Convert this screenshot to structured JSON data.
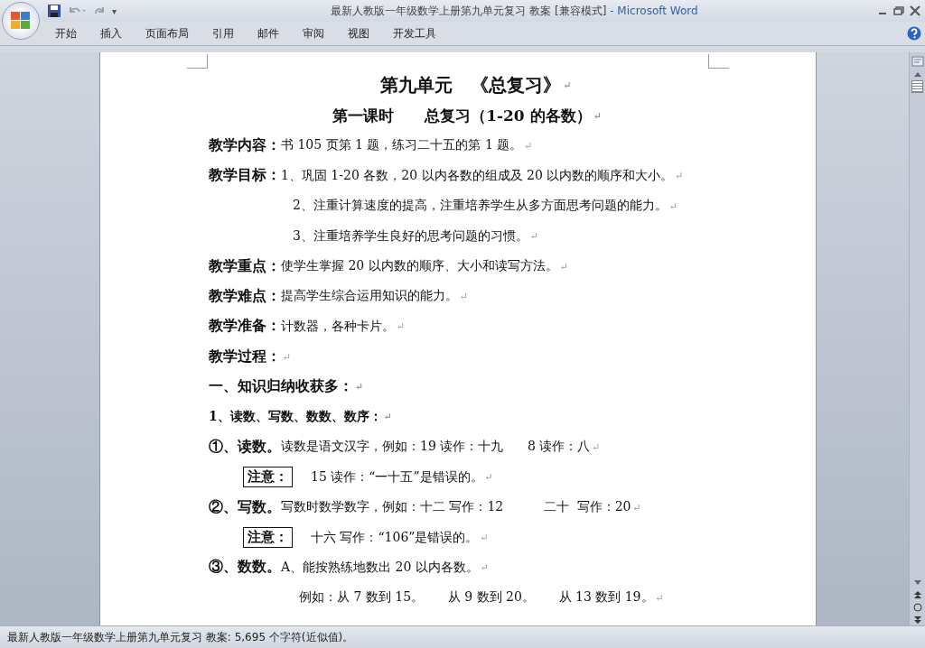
{
  "window": {
    "title": "最新人教版一年级数学上册第九单元复习 教案 [兼容模式]",
    "app": " - Microsoft Word",
    "quick_access": [
      "▾"
    ]
  },
  "tabs": [
    {
      "label": "开始",
      "selected": false
    },
    {
      "label": "插入",
      "selected": false
    },
    {
      "label": "页面布局",
      "selected": false
    },
    {
      "label": "引用",
      "selected": false
    },
    {
      "label": "邮件",
      "selected": false
    },
    {
      "label": "审阅",
      "selected": false
    },
    {
      "label": "视图",
      "selected": false
    },
    {
      "label": "开发工具",
      "selected": false
    }
  ],
  "document": {
    "lines": [
      {
        "kind": "title",
        "text": "第九单元　《总复习》",
        "end": "↵"
      },
      {
        "kind": "subtitle",
        "text": "第一课时　　总复习（1-20 的各数）",
        "end": "↵"
      },
      {
        "kind": "field",
        "label": "教学内容：",
        "text": "书 105 页第 1 题，练习二十五的第 1 题。",
        "end": "↵"
      },
      {
        "kind": "field",
        "label": "教学目标：",
        "text": "1、巩固 1-20 各数，20 以内各数的组成及 20 以内数的顺序和大小。",
        "end": "↵"
      },
      {
        "kind": "indent",
        "text": "2、注重计算速度的提高，注重培养学生从多方面思考问题的能力。",
        "end": "↵"
      },
      {
        "kind": "indent",
        "text": "3、注重培养学生良好的思考问题的习惯。",
        "end": "↵"
      },
      {
        "kind": "field",
        "label": "教学重点：",
        "text": "使学生掌握 20 以内数的顺序、大小和读写方法。",
        "end": "↵"
      },
      {
        "kind": "field",
        "label": "教学难点：",
        "text": "提高学生综合运用知识的能力。",
        "end": "↵"
      },
      {
        "kind": "field",
        "label": "教学准备：",
        "text": "计数器，各种卡片。",
        "end": "↵"
      },
      {
        "kind": "field",
        "label": "教学过程：",
        "end": "↵"
      },
      {
        "kind": "heading",
        "text": "一、知识归纳收获多：",
        "end": "↵"
      },
      {
        "kind": "subheading",
        "text": "1、读数、写数、数数、数序：",
        "end": "↵"
      },
      {
        "kind": "field",
        "label": "①、读数。",
        "text": "读数是语文汉字，例如：19 读作：十九      8 读作：八",
        "end": "↵"
      },
      {
        "kind": "note",
        "label": "注意：",
        "text": "15 读作：“一十五”是错误的。",
        "end": "↵"
      },
      {
        "kind": "field",
        "label": "②、写数。",
        "text": "写数时数学数字，例如：十二 写作：12          二十  写作：20",
        "end": "↵"
      },
      {
        "kind": "note",
        "label": "注意：",
        "text": "十六 写作：“106”是错误的。",
        "end": "↵"
      },
      {
        "kind": "field",
        "label": "③、数数。",
        "text": "A、能按熟练地数出 20 以内各数。",
        "end": "↵"
      },
      {
        "kind": "example",
        "text": "例如：从 7 数到 15。      从 9 数到 20。      从 13 数到 19。",
        "end": "↵"
      }
    ]
  },
  "status_bar": {
    "text": "最新人教版一年级数学上册第九单元复习 教案: 5,695 个字符(近似值)。"
  }
}
